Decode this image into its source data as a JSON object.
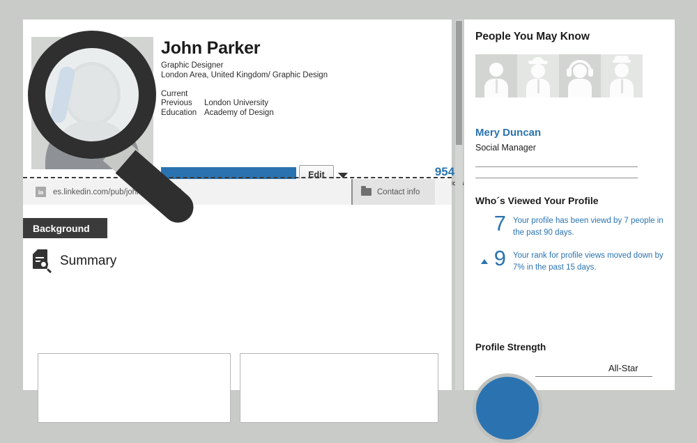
{
  "profile": {
    "name": "John Parker",
    "headline": "Graphic Designer",
    "location": "London Area, United Kingdom/ Graphic Design",
    "meta": [
      {
        "key": "Current",
        "value": ""
      },
      {
        "key": "Previous",
        "value": "London University"
      },
      {
        "key": "Education",
        "value": "Academy of Design"
      }
    ],
    "edit_label": "Edit",
    "connections_count": "954",
    "connections_label": "connections",
    "url": "es.linkedin.com/pub/johnparker/98/6",
    "linkedin_mark": "in",
    "contact_info_label": "Contact info",
    "background_tab_label": "Background",
    "summary_title": "Summary"
  },
  "right": {
    "pymk_title": "People You May Know",
    "suggestion_name": "Mery Duncan",
    "suggestion_role": "Social Manager",
    "avatars": [
      {
        "name": "avatar-businessman"
      },
      {
        "name": "avatar-hardhat-worker"
      },
      {
        "name": "avatar-headset-operator"
      },
      {
        "name": "avatar-capped-officer"
      }
    ],
    "viewed_title": "Who´s Viewed Your Profile",
    "stats": [
      {
        "number": "7",
        "arrow": false,
        "text": "Your profile has been viewd by 7 people in the past 90 days."
      },
      {
        "number": "9",
        "arrow": true,
        "text": "Your rank for profile views moved down by 7% in the past 15 days."
      }
    ],
    "strength_title": "Profile Strength",
    "strength_level": "All-Star"
  },
  "colors": {
    "accent_blue": "#2a73b0",
    "dark_tab": "#3b3b3b",
    "page_bg": "#c9cbc9",
    "panel_bg": "#ffffff",
    "strip_bg": "#f2f2f2"
  }
}
